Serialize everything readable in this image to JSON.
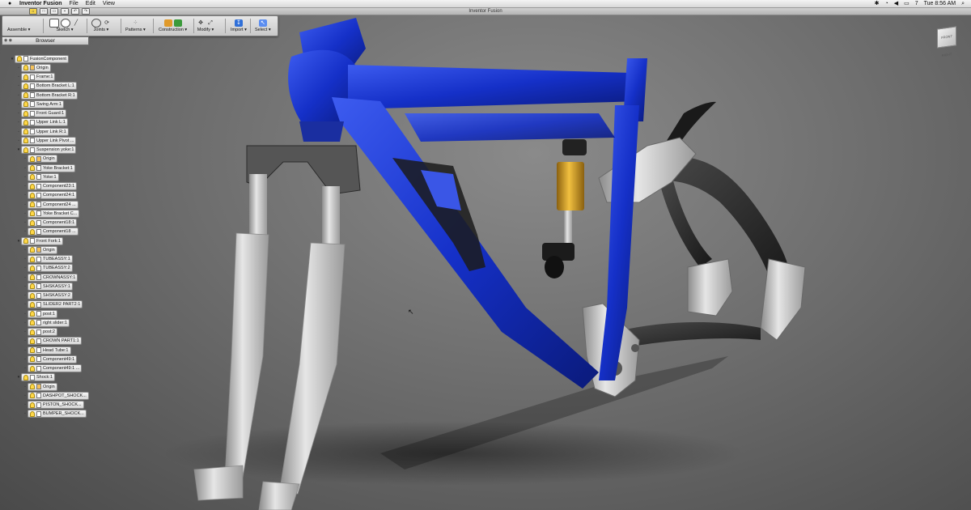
{
  "menubar": {
    "apple": "",
    "app_name": "Inventor Fusion",
    "menus": [
      "File",
      "Edit",
      "View"
    ],
    "battery": "7",
    "clock": "Tue 8:56 AM"
  },
  "window": {
    "title": "Inventor Fusion"
  },
  "ribbon": {
    "groups": [
      {
        "label": "Assemble ▾"
      },
      {
        "label": "Sketch ▾"
      },
      {
        "label": "Joints ▾"
      },
      {
        "label": "Patterns ▾"
      },
      {
        "label": "Construction ▾"
      },
      {
        "label": "Modify ▾"
      },
      {
        "label": "Import ▾"
      },
      {
        "label": "Select ▾"
      }
    ]
  },
  "browser": {
    "title": "Browser",
    "items": [
      {
        "label": "FusionComponent",
        "level": 0,
        "expanded": true
      },
      {
        "label": "Origin",
        "level": 1
      },
      {
        "label": "Frame:1",
        "level": 1
      },
      {
        "label": "Bottom Bracket L:1",
        "level": 1
      },
      {
        "label": "Bottom Bracket R:1",
        "level": 1
      },
      {
        "label": "Swing Arm:1",
        "level": 1
      },
      {
        "label": "Front Guard:1",
        "level": 1
      },
      {
        "label": "Upper Link L:1",
        "level": 1
      },
      {
        "label": "Upper Link R:1",
        "level": 1
      },
      {
        "label": "Upper Link Pivot ...",
        "level": 1
      },
      {
        "label": "Suspension yoke:1",
        "level": 1,
        "expanded": true
      },
      {
        "label": "Origin",
        "level": 2
      },
      {
        "label": "Yoke Bracket:1",
        "level": 2
      },
      {
        "label": "Yoke:1",
        "level": 2
      },
      {
        "label": "Component23:1",
        "level": 2
      },
      {
        "label": "Component24:1",
        "level": 2
      },
      {
        "label": "Component24 ...",
        "level": 2
      },
      {
        "label": "Yoke Bracket C...",
        "level": 2
      },
      {
        "label": "Component18:1",
        "level": 2
      },
      {
        "label": "Component18 ...",
        "level": 2
      },
      {
        "label": "Front Fork:1",
        "level": 1,
        "expanded": true
      },
      {
        "label": "Origin",
        "level": 2
      },
      {
        "label": "TUBEASSY:1",
        "level": 2
      },
      {
        "label": "TUBEASSY:2",
        "level": 2
      },
      {
        "label": "CROWNASSY:1",
        "level": 2
      },
      {
        "label": "SHSKASSY:1",
        "level": 2
      },
      {
        "label": "SHSKASSY:2",
        "level": 2
      },
      {
        "label": "SLIDER2 PART2:1",
        "level": 2
      },
      {
        "label": "post:1",
        "level": 2
      },
      {
        "label": "right slider:1",
        "level": 2
      },
      {
        "label": "post:2",
        "level": 2
      },
      {
        "label": "CROWN PART1:1",
        "level": 2
      },
      {
        "label": "Head Tube:1",
        "level": 2
      },
      {
        "label": "Component49:1",
        "level": 2
      },
      {
        "label": "Component49:1 ...",
        "level": 2
      },
      {
        "label": "Shock:1",
        "level": 1,
        "expanded": true
      },
      {
        "label": "Origin",
        "level": 2
      },
      {
        "label": "DASHPOT_SHOCK...",
        "level": 2
      },
      {
        "label": "PISTON_SHOCK...",
        "level": 2
      },
      {
        "label": "BUMPER_SHOCK...",
        "level": 2
      }
    ]
  },
  "viewcube": {
    "label": "FRONT RIGHT"
  },
  "colors": {
    "frame": "#1530c8",
    "shock": "#d9a020",
    "fork": "#c8c8c8",
    "carbon": "#2a2a2a"
  }
}
